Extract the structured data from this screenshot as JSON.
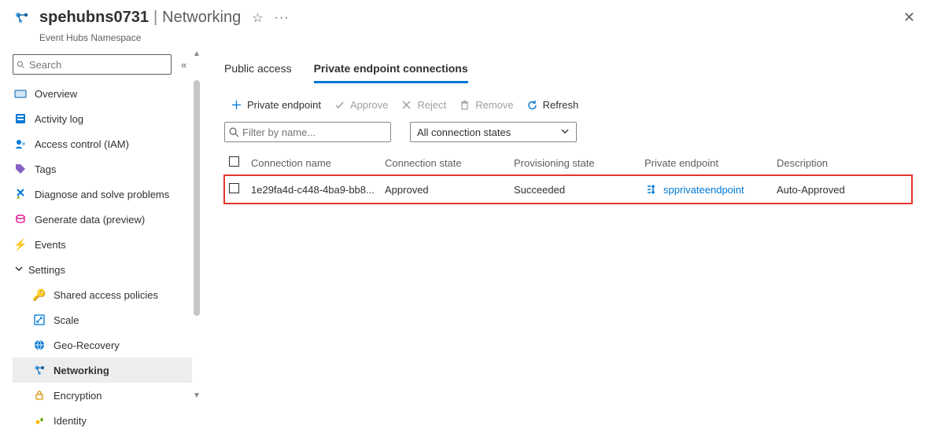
{
  "header": {
    "title": "spehubns0731",
    "section": "Networking",
    "subtitle": "Event Hubs Namespace"
  },
  "search": {
    "placeholder": "Search"
  },
  "sidebar": {
    "overview": "Overview",
    "activity": "Activity log",
    "access": "Access control (IAM)",
    "tags": "Tags",
    "diagnose": "Diagnose and solve problems",
    "generate": "Generate data (preview)",
    "events": "Events",
    "settings_group": "Settings",
    "shared": "Shared access policies",
    "scale": "Scale",
    "geo": "Geo-Recovery",
    "networking": "Networking",
    "encryption": "Encryption",
    "identity": "Identity"
  },
  "tabs": {
    "public": "Public access",
    "private": "Private endpoint connections"
  },
  "toolbar": {
    "add": "Private endpoint",
    "approve": "Approve",
    "reject": "Reject",
    "remove": "Remove",
    "refresh": "Refresh"
  },
  "filter": {
    "placeholder": "Filter by name...",
    "state": "All connection states"
  },
  "table": {
    "headers": {
      "name": "Connection name",
      "state": "Connection state",
      "prov": "Provisioning state",
      "endpoint": "Private endpoint",
      "desc": "Description"
    },
    "rows": [
      {
        "name": "1e29fa4d-c448-4ba9-bb8...",
        "state": "Approved",
        "prov": "Succeeded",
        "endpoint": "spprivateendpoint",
        "desc": "Auto-Approved"
      }
    ]
  }
}
